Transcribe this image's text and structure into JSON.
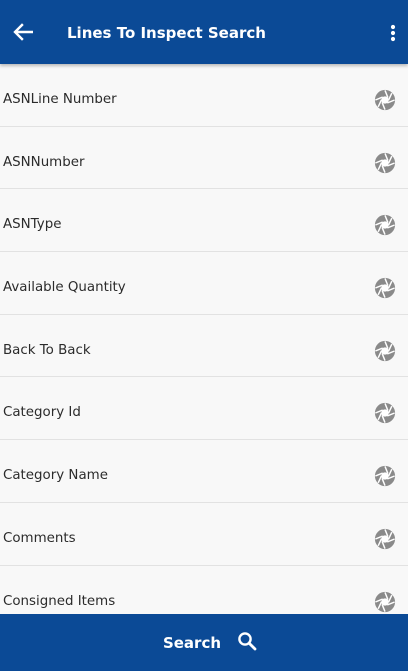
{
  "header": {
    "title": "Lines To Inspect Search",
    "back_icon": "arrow-left-icon",
    "menu_icon": "more-vertical-icon"
  },
  "fields": [
    {
      "label": "ASNLine Number",
      "icon": "aperture-icon"
    },
    {
      "label": "ASNNumber",
      "icon": "aperture-icon"
    },
    {
      "label": "ASNType",
      "icon": "aperture-icon"
    },
    {
      "label": "Available Quantity",
      "icon": "aperture-icon"
    },
    {
      "label": "Back To Back",
      "icon": "aperture-icon"
    },
    {
      "label": "Category Id",
      "icon": "aperture-icon"
    },
    {
      "label": "Category Name",
      "icon": "aperture-icon"
    },
    {
      "label": "Comments",
      "icon": "aperture-icon"
    },
    {
      "label": "Consigned Items",
      "icon": "aperture-icon"
    }
  ],
  "footer": {
    "search_label": "Search",
    "search_icon": "search-icon"
  },
  "colors": {
    "primary": "#0b4a96",
    "row_background": "#f8f8f8",
    "icon_gray": "#8a8a8a"
  }
}
